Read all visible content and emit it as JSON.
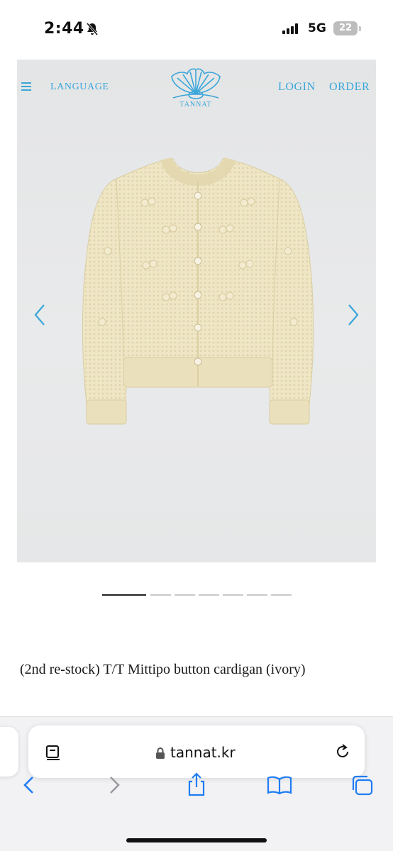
{
  "status_bar": {
    "time": "2:44",
    "network": "5G",
    "battery": "22"
  },
  "site": {
    "nav": {
      "language": "LANGUAGE",
      "login": "LOGIN",
      "order": "ORDER"
    },
    "logo_text": "TANNAT",
    "accent_color": "#3aa6da"
  },
  "gallery": {
    "image_count": 7,
    "active_index": 0
  },
  "product": {
    "title": "(2nd re-stock) T/T Mittipo button cardigan (ivory)"
  },
  "browser": {
    "url": "tannat.kr",
    "tint_color": "#1f7cf2"
  },
  "icons": {
    "menu": "menu-icon",
    "prev": "chevron-left-icon",
    "next": "chevron-right-icon",
    "reader": "reader-icon",
    "lock": "lock-icon",
    "reload": "reload-icon",
    "back": "back-icon",
    "forward": "forward-icon",
    "share": "share-icon",
    "bookmarks": "bookmarks-icon",
    "tabs": "tabs-icon"
  }
}
